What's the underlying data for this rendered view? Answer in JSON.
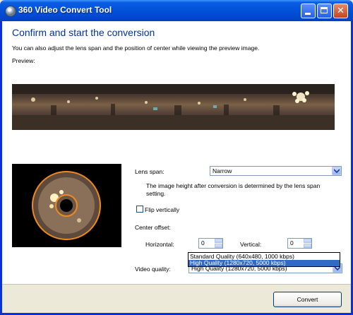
{
  "window": {
    "title": "360 Video Convert Tool"
  },
  "page": {
    "heading": "Confirm and start the conversion",
    "intro": "You can also adjust the lens span and the position of center while viewing the preview image.",
    "preview_label": "Preview:"
  },
  "lens": {
    "label": "Lens span:",
    "value": "Narrow",
    "note": "The image height after conversion is determined by the lens span setting."
  },
  "flip": {
    "label": "Flip vertically",
    "checked": false
  },
  "offset": {
    "label": "Center offset:",
    "horizontal_label": "Horizontal:",
    "horizontal_value": "0",
    "vertical_label": "Vertical:",
    "vertical_value": "0"
  },
  "quality": {
    "label": "Video quality:",
    "value": "High Quality (1280x720, 5000 kbps)",
    "options": [
      "Standard Quality (640x480, 1000 kbps)",
      "High Quality (1280x720, 5000 kbps)"
    ],
    "selected_index": 1
  },
  "footer": {
    "convert_label": "Convert"
  },
  "colors": {
    "heading": "#003399",
    "accent": "#316ac5",
    "titlebar": "#0454dc",
    "ring": "#f08a1e"
  }
}
